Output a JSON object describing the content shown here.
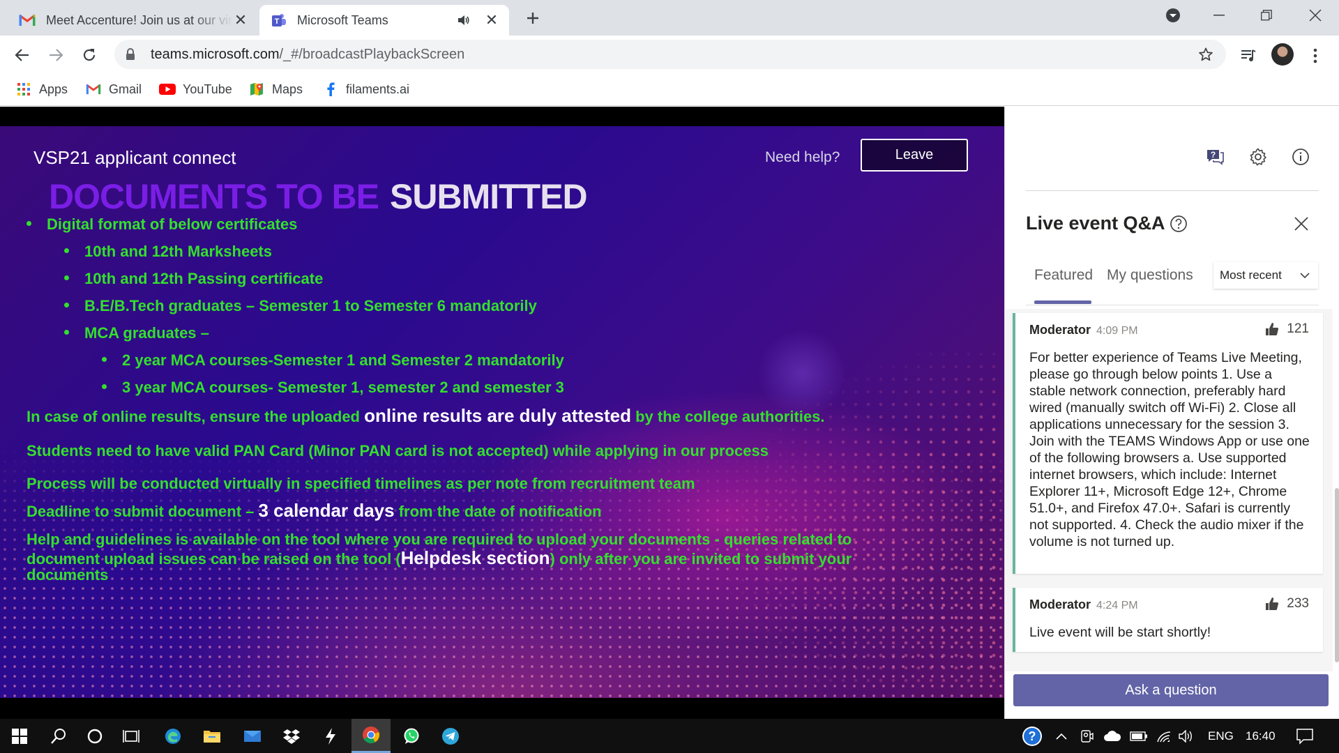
{
  "browser": {
    "tabs": [
      {
        "title": "Meet Accenture! Join us at our virtual session",
        "favicon": "gmail-icon",
        "active": false
      },
      {
        "title": "Microsoft Teams",
        "favicon": "teams-icon",
        "active": true,
        "audio": true
      }
    ],
    "url_host": "teams.microsoft.com",
    "url_path": "/_#/broadcastPlaybackScreen",
    "bookmarks": [
      {
        "label": "Apps",
        "icon": "apps-grid-icon"
      },
      {
        "label": "Gmail",
        "icon": "gmail-icon"
      },
      {
        "label": "YouTube",
        "icon": "youtube-icon"
      },
      {
        "label": "Maps",
        "icon": "maps-icon"
      },
      {
        "label": "filaments.ai",
        "icon": "facebook-icon"
      }
    ]
  },
  "event": {
    "title": "VSP21 applicant connect",
    "need_help": "Need help?",
    "leave_label": "Leave"
  },
  "slide": {
    "heading_part1": "DOCUMENTS TO BE",
    "heading_part2": "SUBMITTED",
    "line1": "Digital format of below certificates",
    "line2": "10th and 12th Marksheets",
    "line3": "10th and 12th Passing certificate",
    "line4": "B.E/B.Tech graduates – Semester 1 to Semester 6 mandatorily",
    "line5": "MCA graduates –",
    "line6": "2 year MCA courses-Semester 1 and Semester 2 mandatorily",
    "line7": "3 year MCA courses- Semester 1, semester 2 and semester 3",
    "line8a": "In case of online results, ensure the uploaded ",
    "line8b": "online results are duly attested",
    "line8c": " by the college authorities.",
    "line9": "Students need to have valid PAN Card (Minor PAN card is not accepted) while applying in our process",
    "line10": "Process will be conducted virtually in specified timelines as per note from recruitment team",
    "line11a": "Deadline to submit document – ",
    "line11b": "3 calendar days",
    "line11c": " from the date of notification",
    "line12": "Help and guidelines is available on the tool where you are required to upload your documents - queries related to",
    "line13a": "document upload issues can be raised on the tool (",
    "line13b": "Helpdesk section",
    "line13c": ") only after you are invited to submit your",
    "line14": "documents"
  },
  "qa": {
    "title": "Live event Q&A",
    "tabs": [
      {
        "label": "Featured",
        "selected": true
      },
      {
        "label": "My questions",
        "selected": false
      }
    ],
    "sort_label": "Most recent",
    "posts": [
      {
        "author": "Moderator",
        "time": "4:09 PM",
        "likes": "121",
        "text": "For better experience of Teams Live Meeting, please go through below points 1. Use a stable network connection, preferably hard wired (manually switch off Wi-Fi) 2. Close all applications unnecessary for the session 3. Join with the TEAMS Windows App or use one of the following browsers a. Use supported internet browsers, which include: Internet Explorer 11+, Microsoft Edge 12+, Chrome 51.0+, and Firefox 47.0+. Safari is currently not supported. 4. Check the audio mixer if the volume is not turned up."
      },
      {
        "author": "Moderator",
        "time": "4:24 PM",
        "likes": "233",
        "text": "Live event will be start shortly!"
      }
    ],
    "ask_label": "Ask a question"
  },
  "taskbar": {
    "language": "ENG",
    "clock": "16:40"
  },
  "colors": {
    "teams_accent": "#6264a7",
    "slide_green": "#33e02c",
    "card_border": "#6bb49f"
  }
}
